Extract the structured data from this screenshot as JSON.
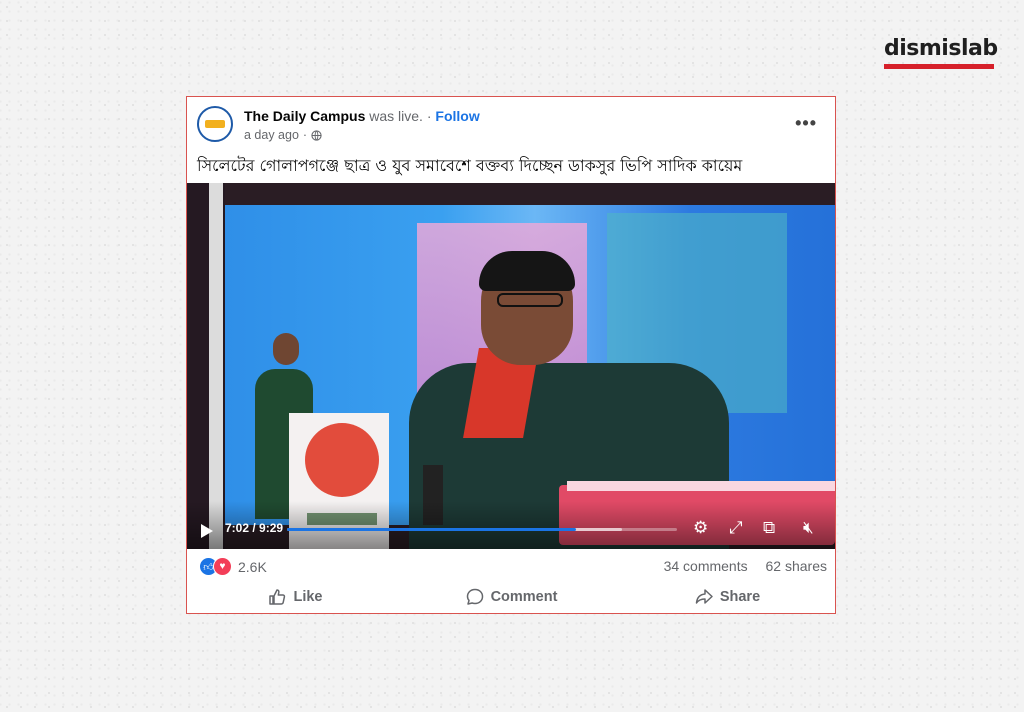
{
  "brand": {
    "logo_text": "dismislab",
    "accent_color": "#d6202a"
  },
  "post": {
    "page_name": "The Daily Campus",
    "status": "was live.",
    "separator": "·",
    "follow_label": "Follow",
    "time_ago": "a day ago",
    "time_sep": "·",
    "audience_icon": "globe-icon",
    "more_icon": "more-options-icon",
    "text": "সিলেটের গোলাপগঞ্জে ছাত্র ও যুব সমাবেশে বক্তব্য দিচ্ছেন ডাকসুর ভিপি সাদিক কায়েম"
  },
  "video": {
    "current_time": "7:02",
    "duration": "9:29",
    "time_display": "7:02 / 9:29",
    "progress": 0.74,
    "buffered": 0.86,
    "controls": [
      "play-icon",
      "settings-icon",
      "fullscreen-icon",
      "picture-in-picture-icon",
      "volume-muted-icon"
    ]
  },
  "stats": {
    "reaction_icons": [
      "like-reaction-icon",
      "love-reaction-icon"
    ],
    "reaction_count": "2.6K",
    "comments": "34 comments",
    "shares": "62 shares"
  },
  "actions": {
    "like_label": "Like",
    "comment_label": "Comment",
    "share_label": "Share"
  }
}
